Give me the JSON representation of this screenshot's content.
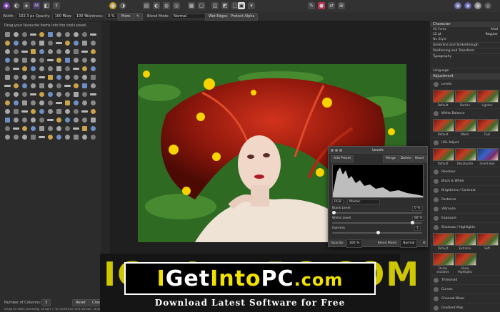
{
  "context_bar": {
    "width_label": "Width:",
    "width_value": "102.3 px",
    "opacity_label": "Opacity:",
    "opacity_value": "100 %",
    "flow_label": "Flow:",
    "flow_value": "100 %",
    "hardness_label": "Hardness:",
    "hardness_value": "0 %",
    "more_label": "More",
    "blend_mode_label": "Blend Mode:",
    "blend_mode_value": "Normal",
    "wet_edges_label": "Wet Edges",
    "protect_alpha_label": "Protect Alpha"
  },
  "left_panel": {
    "hint": "Drag your favourite items into the tools panel",
    "columns_label": "Number of Columns:",
    "columns_value": "3",
    "reset_label": "Reset",
    "close_label": "Close",
    "status_text": "Drag to start painting. Drag+⇧ to continue last stroke. Drag+⌥ to use colour..."
  },
  "levels_dialog": {
    "title": "Levels",
    "add_preset": "Add Preset",
    "merge": "Merge",
    "delete": "Delete",
    "reset": "Reset",
    "channel": "RGB",
    "master": "Master",
    "black_level_label": "Black Level",
    "black_level_value": "0 %",
    "white_level_label": "White Level",
    "white_level_value": "88 %",
    "gamma_label": "Gamma",
    "gamma_value": "1",
    "opacity_label": "Opacity:",
    "opacity_value": "100 %",
    "blend_mode_label": "Blend Mode:",
    "blend_mode_value": "Normal"
  },
  "right_panel": {
    "character_tab": "Character",
    "font_family_label": "All Fonts",
    "font_family_value": "Arial",
    "font_size_value": "12 pt",
    "font_style_value": "Regular",
    "no_style": "No Style",
    "underline_section": "Underline and Strikethrough",
    "positioning_section": "Positioning and Transform",
    "typography_section": "Typography",
    "language_section": "Language",
    "adjustment_tab": "Adjustment",
    "adjustments": {
      "levels": "Levels",
      "levels_thumbs": [
        "Default",
        "Darken",
        "Lighten"
      ],
      "white_balance": "White Balance",
      "white_balance_thumbs": [
        "Default",
        "Warm",
        "Cool"
      ],
      "hsl": "HSL Adjust",
      "hsl_thumbs": [
        "Default",
        "Desaturate",
        "Invert Hue"
      ],
      "recolour": "Recolour",
      "black_white": "Black & White",
      "brightness": "Brightness / Contrast",
      "posterise": "Posterise",
      "vibrance": "Vibrance",
      "exposure": "Exposure",
      "shadows": "Shadows / Highlights",
      "shadows_thumbs": [
        "Default",
        "Extreme",
        "Soft"
      ],
      "shadows_thumbs2": [
        "Dump shadows",
        "Show Highlights"
      ],
      "threshold": "Threshold",
      "curves": "Curves",
      "channel_mixer": "Channel Mixer",
      "gradient_map": "Gradient Map"
    }
  },
  "banner": {
    "bg_text": "IGetIntoPC.COM",
    "main_1": "I",
    "main_2": "Get",
    "main_3": "Into",
    "main_4": "PC",
    "main_5": ".com",
    "subtitle": "Download Latest Software for Free"
  },
  "colors": {
    "accent": "#f2e200",
    "dark_bg": "#2a2a2a",
    "panel_bg": "#2c2c2c"
  }
}
